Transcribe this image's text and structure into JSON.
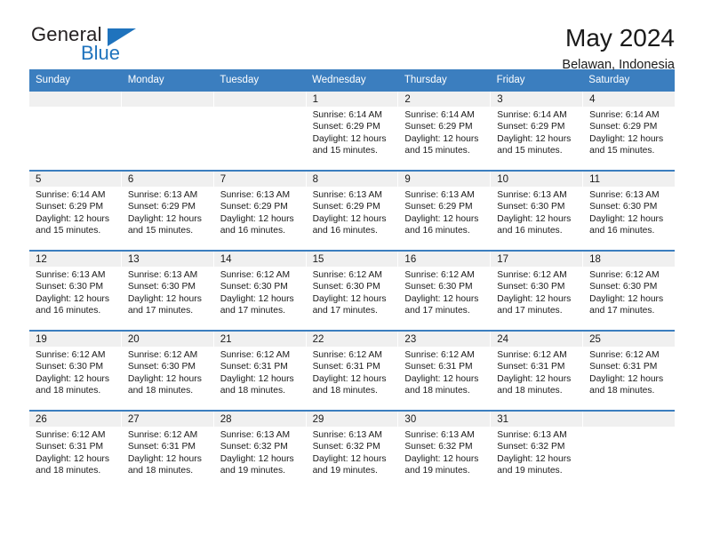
{
  "logo": {
    "word_one": "General",
    "word_two": "Blue",
    "triangle_icon": "blue-triangle-icon",
    "brand_color": "#1f73bd"
  },
  "header": {
    "title": "May 2024",
    "subtitle": "Belawan, Indonesia"
  },
  "theme": {
    "header_row_bg": "#3b7ebf",
    "header_row_text": "#ffffff",
    "day_band_bg": "#f0f0f0",
    "week_divider": "#3b7ebf"
  },
  "calendar": {
    "weekdays": [
      "Sunday",
      "Monday",
      "Tuesday",
      "Wednesday",
      "Thursday",
      "Friday",
      "Saturday"
    ],
    "weeks": [
      [
        {
          "day": "",
          "info": ""
        },
        {
          "day": "",
          "info": ""
        },
        {
          "day": "",
          "info": ""
        },
        {
          "day": "1",
          "info": "Sunrise: 6:14 AM\nSunset: 6:29 PM\nDaylight: 12 hours\nand 15 minutes."
        },
        {
          "day": "2",
          "info": "Sunrise: 6:14 AM\nSunset: 6:29 PM\nDaylight: 12 hours\nand 15 minutes."
        },
        {
          "day": "3",
          "info": "Sunrise: 6:14 AM\nSunset: 6:29 PM\nDaylight: 12 hours\nand 15 minutes."
        },
        {
          "day": "4",
          "info": "Sunrise: 6:14 AM\nSunset: 6:29 PM\nDaylight: 12 hours\nand 15 minutes."
        }
      ],
      [
        {
          "day": "5",
          "info": "Sunrise: 6:14 AM\nSunset: 6:29 PM\nDaylight: 12 hours\nand 15 minutes."
        },
        {
          "day": "6",
          "info": "Sunrise: 6:13 AM\nSunset: 6:29 PM\nDaylight: 12 hours\nand 15 minutes."
        },
        {
          "day": "7",
          "info": "Sunrise: 6:13 AM\nSunset: 6:29 PM\nDaylight: 12 hours\nand 16 minutes."
        },
        {
          "day": "8",
          "info": "Sunrise: 6:13 AM\nSunset: 6:29 PM\nDaylight: 12 hours\nand 16 minutes."
        },
        {
          "day": "9",
          "info": "Sunrise: 6:13 AM\nSunset: 6:29 PM\nDaylight: 12 hours\nand 16 minutes."
        },
        {
          "day": "10",
          "info": "Sunrise: 6:13 AM\nSunset: 6:30 PM\nDaylight: 12 hours\nand 16 minutes."
        },
        {
          "day": "11",
          "info": "Sunrise: 6:13 AM\nSunset: 6:30 PM\nDaylight: 12 hours\nand 16 minutes."
        }
      ],
      [
        {
          "day": "12",
          "info": "Sunrise: 6:13 AM\nSunset: 6:30 PM\nDaylight: 12 hours\nand 16 minutes."
        },
        {
          "day": "13",
          "info": "Sunrise: 6:13 AM\nSunset: 6:30 PM\nDaylight: 12 hours\nand 17 minutes."
        },
        {
          "day": "14",
          "info": "Sunrise: 6:12 AM\nSunset: 6:30 PM\nDaylight: 12 hours\nand 17 minutes."
        },
        {
          "day": "15",
          "info": "Sunrise: 6:12 AM\nSunset: 6:30 PM\nDaylight: 12 hours\nand 17 minutes."
        },
        {
          "day": "16",
          "info": "Sunrise: 6:12 AM\nSunset: 6:30 PM\nDaylight: 12 hours\nand 17 minutes."
        },
        {
          "day": "17",
          "info": "Sunrise: 6:12 AM\nSunset: 6:30 PM\nDaylight: 12 hours\nand 17 minutes."
        },
        {
          "day": "18",
          "info": "Sunrise: 6:12 AM\nSunset: 6:30 PM\nDaylight: 12 hours\nand 17 minutes."
        }
      ],
      [
        {
          "day": "19",
          "info": "Sunrise: 6:12 AM\nSunset: 6:30 PM\nDaylight: 12 hours\nand 18 minutes."
        },
        {
          "day": "20",
          "info": "Sunrise: 6:12 AM\nSunset: 6:30 PM\nDaylight: 12 hours\nand 18 minutes."
        },
        {
          "day": "21",
          "info": "Sunrise: 6:12 AM\nSunset: 6:31 PM\nDaylight: 12 hours\nand 18 minutes."
        },
        {
          "day": "22",
          "info": "Sunrise: 6:12 AM\nSunset: 6:31 PM\nDaylight: 12 hours\nand 18 minutes."
        },
        {
          "day": "23",
          "info": "Sunrise: 6:12 AM\nSunset: 6:31 PM\nDaylight: 12 hours\nand 18 minutes."
        },
        {
          "day": "24",
          "info": "Sunrise: 6:12 AM\nSunset: 6:31 PM\nDaylight: 12 hours\nand 18 minutes."
        },
        {
          "day": "25",
          "info": "Sunrise: 6:12 AM\nSunset: 6:31 PM\nDaylight: 12 hours\nand 18 minutes."
        }
      ],
      [
        {
          "day": "26",
          "info": "Sunrise: 6:12 AM\nSunset: 6:31 PM\nDaylight: 12 hours\nand 18 minutes."
        },
        {
          "day": "27",
          "info": "Sunrise: 6:12 AM\nSunset: 6:31 PM\nDaylight: 12 hours\nand 18 minutes."
        },
        {
          "day": "28",
          "info": "Sunrise: 6:13 AM\nSunset: 6:32 PM\nDaylight: 12 hours\nand 19 minutes."
        },
        {
          "day": "29",
          "info": "Sunrise: 6:13 AM\nSunset: 6:32 PM\nDaylight: 12 hours\nand 19 minutes."
        },
        {
          "day": "30",
          "info": "Sunrise: 6:13 AM\nSunset: 6:32 PM\nDaylight: 12 hours\nand 19 minutes."
        },
        {
          "day": "31",
          "info": "Sunrise: 6:13 AM\nSunset: 6:32 PM\nDaylight: 12 hours\nand 19 minutes."
        },
        {
          "day": "",
          "info": ""
        }
      ]
    ]
  }
}
